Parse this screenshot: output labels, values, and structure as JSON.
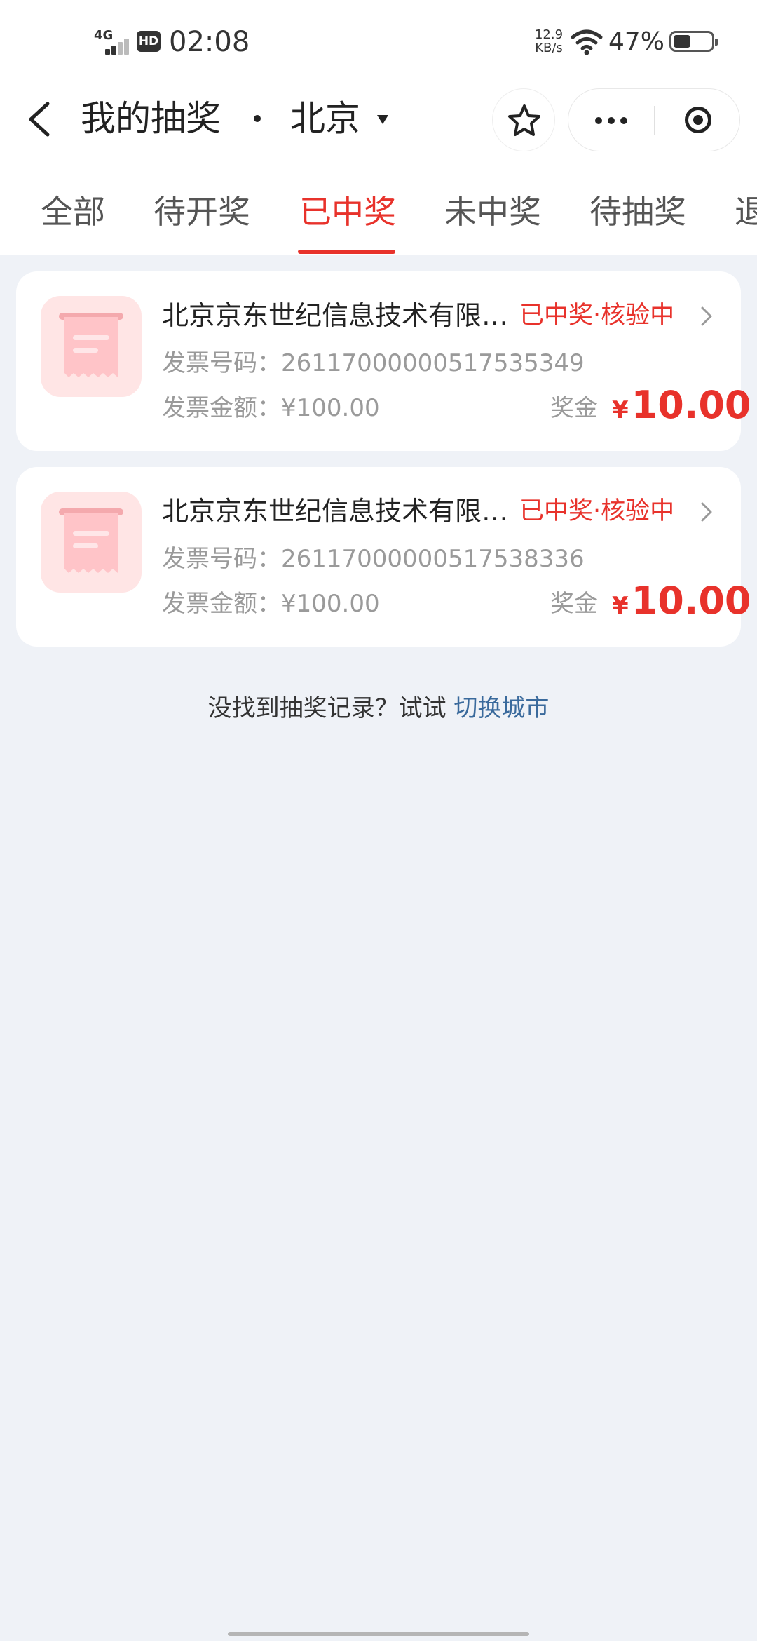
{
  "status_bar": {
    "network": "4G",
    "hd": "HD",
    "time": "02:08",
    "speed_value": "12.9",
    "speed_unit": "KB/s",
    "battery_percent": "47%",
    "battery_level": 0.47
  },
  "nav": {
    "title": "我的抽奖",
    "city": "北京"
  },
  "tabs": [
    {
      "label": "全部",
      "active": false
    },
    {
      "label": "待开奖",
      "active": false
    },
    {
      "label": "已中奖",
      "active": true
    },
    {
      "label": "未中奖",
      "active": false
    },
    {
      "label": "待抽奖",
      "active": false
    },
    {
      "label": "退",
      "active": false
    }
  ],
  "records": [
    {
      "company": "北京京东世纪信息技术有限公司",
      "status": "已中奖·核验中",
      "invoice_number_label": "发票号码：",
      "invoice_number": "26117000000517535349",
      "invoice_amount_label": "发票金额：",
      "invoice_amount": "¥100.00",
      "bonus_label": "奖金",
      "bonus_currency": "¥",
      "bonus_amount": "10.00"
    },
    {
      "company": "北京京东世纪信息技术有限公司",
      "status": "已中奖·核验中",
      "invoice_number_label": "发票号码：",
      "invoice_number": "26117000000517538336",
      "invoice_amount_label": "发票金额：",
      "invoice_amount": "¥100.00",
      "bonus_label": "奖金",
      "bonus_currency": "¥",
      "bonus_amount": "10.00"
    }
  ],
  "hint": {
    "text": "没找到抽奖记录？试试 ",
    "link": "切换城市"
  },
  "colors": {
    "accent": "#e8322b",
    "link": "#3a6a9c",
    "page_background": "#eff2f7",
    "icon_background": "#ffe5e5"
  }
}
